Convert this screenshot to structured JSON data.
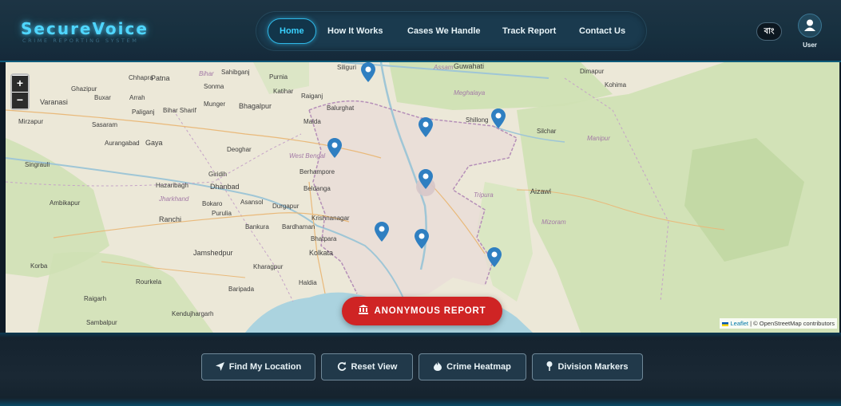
{
  "brand": {
    "title": "SecureVoice",
    "subtitle": "CRIME REPORTING SYSTEM"
  },
  "nav": {
    "items": [
      {
        "label": "Home",
        "active": true
      },
      {
        "label": "How It Works",
        "active": false
      },
      {
        "label": "Cases We Handle",
        "active": false
      },
      {
        "label": "Track Report",
        "active": false
      },
      {
        "label": "Contact Us",
        "active": false
      }
    ]
  },
  "header": {
    "language_button": "বাং",
    "user_label": "User"
  },
  "map": {
    "zoom_in": "+",
    "zoom_out": "−",
    "report_button": "ANONYMOUS REPORT",
    "attribution": {
      "leaflet": "Leaflet",
      "separator": "|",
      "osm": "© OpenStreetMap contributors"
    },
    "marker_icon": "map-pin-icon",
    "marker_color": "#2f7fc1",
    "labels": {
      "cities": [
        "Sahibganj",
        "Purnia",
        "Katihar",
        "Raiganj",
        "Balurghat",
        "Siliguri",
        "Patna",
        "Sonma",
        "Chhapra",
        "Ghazipur",
        "Buxar",
        "Arrah",
        "Paliganj",
        "Bihar Sharif",
        "Munger",
        "Bhagalpur",
        "Mirzapur",
        "Varanasi",
        "Sasaram",
        "Aurangabad",
        "Gaya",
        "Deoghar",
        "Malda",
        "Singrauli",
        "Giridih",
        "Hazaribagh",
        "Dhanbad",
        "Bokaro",
        "Asansol",
        "Durgapur",
        "Purulia",
        "Ranchi",
        "Ambikapur",
        "Bankura",
        "Bardhaman",
        "Krishnanagar",
        "Berhampore",
        "Beldanga",
        "Jamshedpur",
        "Kolkata",
        "Bhatpara",
        "Kharagpur",
        "Haldia",
        "Rourkela",
        "Korba",
        "Raigarh",
        "Baripada",
        "Kendujhargarh",
        "Sambalpur",
        "Guwahati",
        "Dimapur",
        "Kohima",
        "Silchar",
        "Aizawl",
        "Shillong"
      ],
      "states": [
        "Bihar",
        "Assam",
        "Meghalaya",
        "West Bengal",
        "Jharkhand",
        "Tripura",
        "Mizoram",
        "Manipur"
      ]
    }
  },
  "actions": {
    "find_location": "Find My Location",
    "reset_view": "Reset View",
    "crime_heatmap": "Crime Heatmap",
    "division_markers": "Division Markers"
  },
  "colors": {
    "accent": "#39d1ff",
    "report_red": "#cf2424",
    "nav_background": "#1a3a4e"
  }
}
